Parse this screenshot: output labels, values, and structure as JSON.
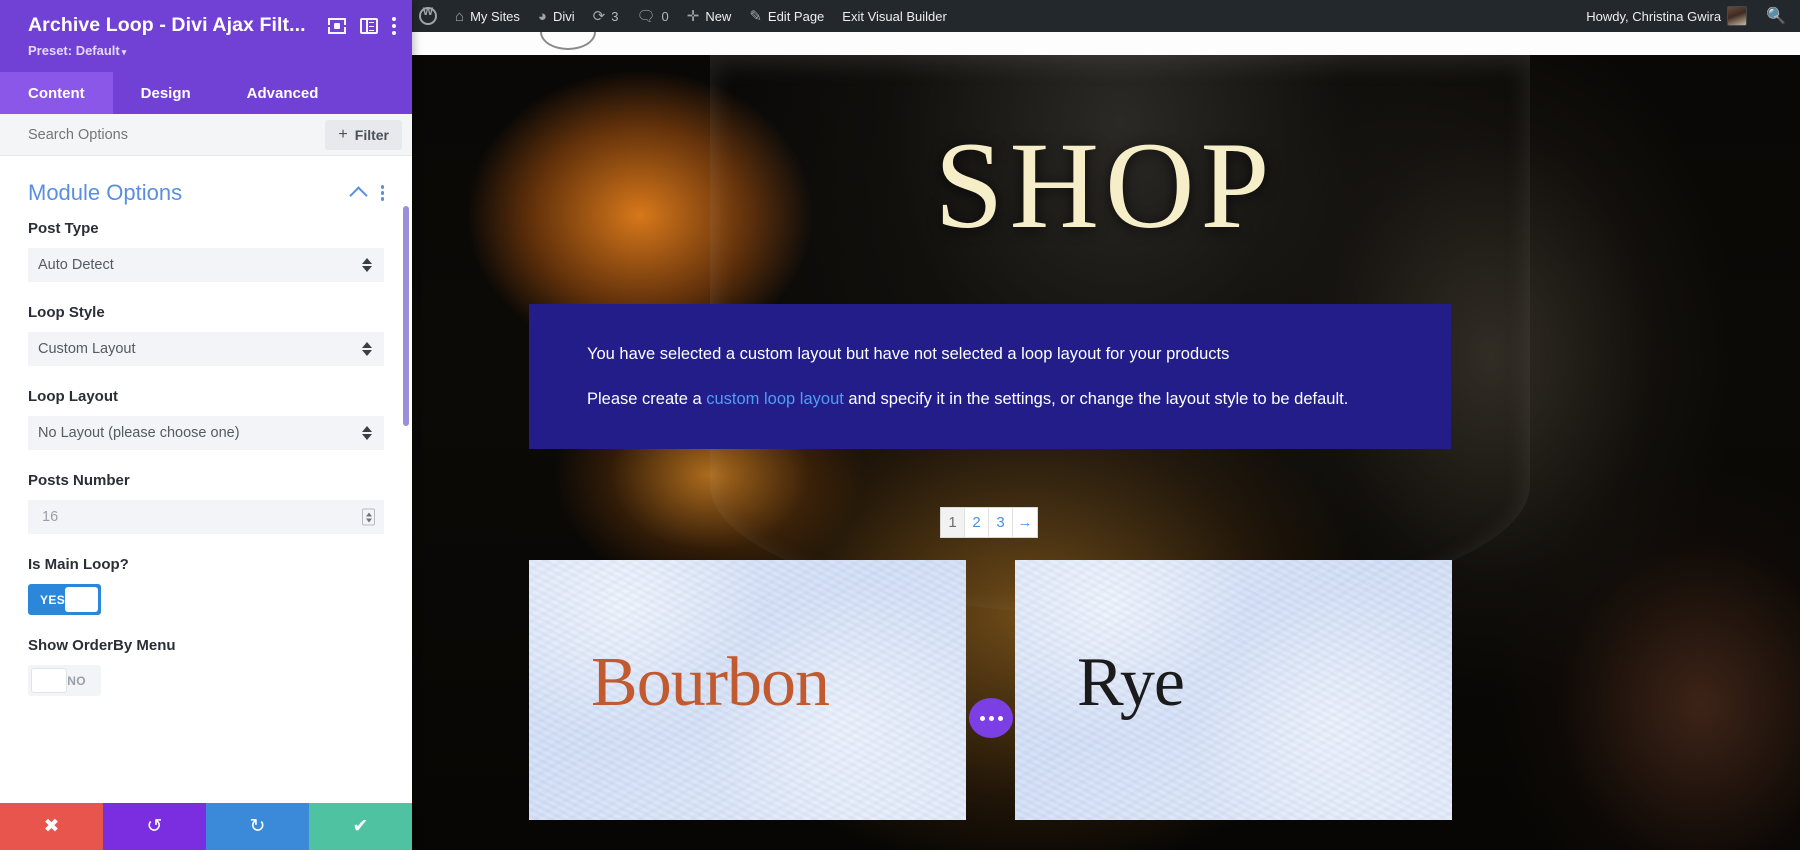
{
  "adminbar": {
    "items": [
      {
        "name": "wp-logo",
        "label": "",
        "icon": "wordpress-icon"
      },
      {
        "name": "my-sites",
        "label": "My Sites",
        "icon": "sites-icon"
      },
      {
        "name": "divi",
        "label": "Divi",
        "icon": "dashboard-icon"
      },
      {
        "name": "updates",
        "label": "3",
        "icon": "updates-icon"
      },
      {
        "name": "comments",
        "label": "0",
        "icon": "comment-icon"
      },
      {
        "name": "new",
        "label": "New",
        "icon": "plus-icon"
      },
      {
        "name": "edit-page",
        "label": "Edit Page",
        "icon": "pencil-icon"
      },
      {
        "name": "exit-visual-builder",
        "label": "Exit Visual Builder",
        "icon": ""
      }
    ],
    "howdy": "Howdy, Christina Gwira",
    "search_icon": "search-icon"
  },
  "panel": {
    "title": "Archive Loop - Divi Ajax Filt...",
    "preset_label": "Preset: Default",
    "preset_caret": "▾",
    "tabs": [
      {
        "label": "Content",
        "active": true
      },
      {
        "label": "Design",
        "active": false
      },
      {
        "label": "Advanced",
        "active": false
      }
    ],
    "search_placeholder": "Search Options",
    "search_value": "",
    "filter_button": "Filter",
    "filter_plus": "+",
    "section": {
      "title": "Module Options"
    },
    "fields": [
      {
        "label": "Post Type",
        "type": "select",
        "value": "Auto Detect"
      },
      {
        "label": "Loop Style",
        "type": "select",
        "value": "Custom Layout"
      },
      {
        "label": "Loop Layout",
        "type": "select",
        "value": "No Layout (please choose one)"
      },
      {
        "label": "Posts Number",
        "type": "number",
        "value": "16"
      },
      {
        "label": "Is Main Loop?",
        "type": "toggle",
        "value": "YES",
        "on": true
      },
      {
        "label": "Show OrderBy Menu",
        "type": "toggle",
        "value": "NO",
        "on": false
      }
    ],
    "actions": [
      {
        "name": "cancel",
        "glyph": "✖"
      },
      {
        "name": "undo",
        "glyph": "↺"
      },
      {
        "name": "redo",
        "glyph": "↻"
      },
      {
        "name": "save",
        "glyph": "✔"
      }
    ],
    "colors": {
      "header": "#7140d4",
      "tab_active": "#8a57e8",
      "section_title": "#5a8fe0",
      "toggle_on": "#2b87da"
    }
  },
  "page": {
    "hero_title": "SHOP",
    "notice": {
      "line1": "You have selected a custom layout but have not selected a loop layout for your products",
      "line2_before": "Please create a ",
      "link": "custom loop layout",
      "line2_after": " and specify it in the settings, or change the layout style to be default.",
      "bg_color": "#231d8a",
      "link_color": "#4e9ef5"
    },
    "pagination": [
      {
        "label": "1",
        "current": true
      },
      {
        "label": "2",
        "current": false
      },
      {
        "label": "3",
        "current": false
      },
      {
        "label": "→",
        "current": false
      }
    ],
    "cards": [
      {
        "title": "Bourbon",
        "color": "#c15a2f"
      },
      {
        "title": "Rye",
        "color": "#1b1b1b"
      }
    ],
    "fab": "ellipsis-icon"
  }
}
